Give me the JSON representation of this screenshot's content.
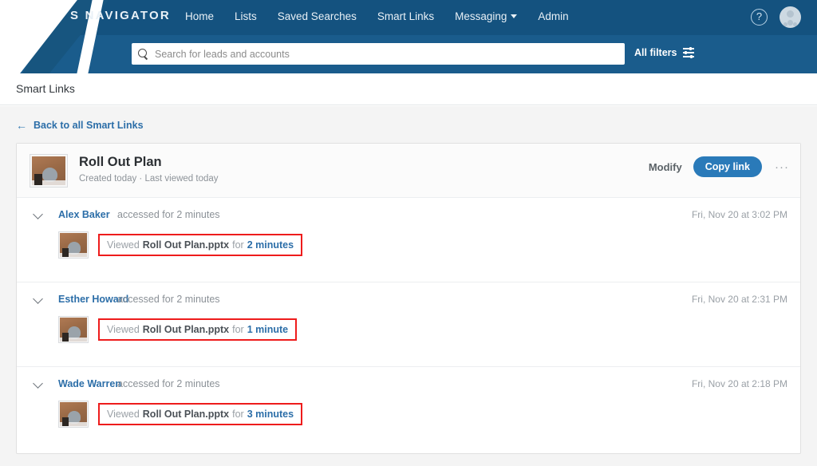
{
  "header": {
    "brand": "S NAVIGATOR",
    "nav_items": [
      {
        "label": "Home",
        "has_caret": false
      },
      {
        "label": "Lists",
        "has_caret": false
      },
      {
        "label": "Saved Searches",
        "has_caret": false
      },
      {
        "label": "Smart Links",
        "has_caret": false
      },
      {
        "label": "Messaging",
        "has_caret": true
      },
      {
        "label": "Admin",
        "has_caret": false
      }
    ],
    "help_glyph": "?",
    "search": {
      "placeholder": "Search for leads and accounts",
      "value": ""
    },
    "all_filters_label": "All filters"
  },
  "page": {
    "title": "Smart Links",
    "back_arrow": "←",
    "back_label": "Back to all Smart Links"
  },
  "card": {
    "title": "Roll Out Plan",
    "subtitle": "Created today  ·  Last viewed today",
    "modify_label": "Modify",
    "copy_link_label": "Copy link",
    "more_label": "···"
  },
  "activity": [
    {
      "name": "Alex Baker",
      "meta": "accessed for 2 minutes",
      "timestamp": "Fri, Nov 20 at 3:02 PM",
      "detail": {
        "viewed": "Viewed",
        "file": "Roll Out Plan.pptx",
        "for": "for",
        "duration": "2 minutes"
      }
    },
    {
      "name": "Esther Howard",
      "meta": "accessed for 2 minutes",
      "timestamp": "Fri, Nov 20 at 2:31 PM",
      "detail": {
        "viewed": "Viewed",
        "file": "Roll Out Plan.pptx",
        "for": "for",
        "duration": "1 minute"
      }
    },
    {
      "name": "Wade Warren",
      "meta": "accessed for 2 minutes",
      "timestamp": "Fri, Nov 20 at 2:18 PM",
      "detail": {
        "viewed": "Viewed",
        "file": "Roll Out Plan.pptx",
        "for": "for",
        "duration": "3 minutes"
      }
    }
  ],
  "colors": {
    "header_blue": "#14527f",
    "accent_blue": "#2c6ea8",
    "button_blue": "#2a7ab9",
    "highlight_red": "#ee1c1c"
  }
}
